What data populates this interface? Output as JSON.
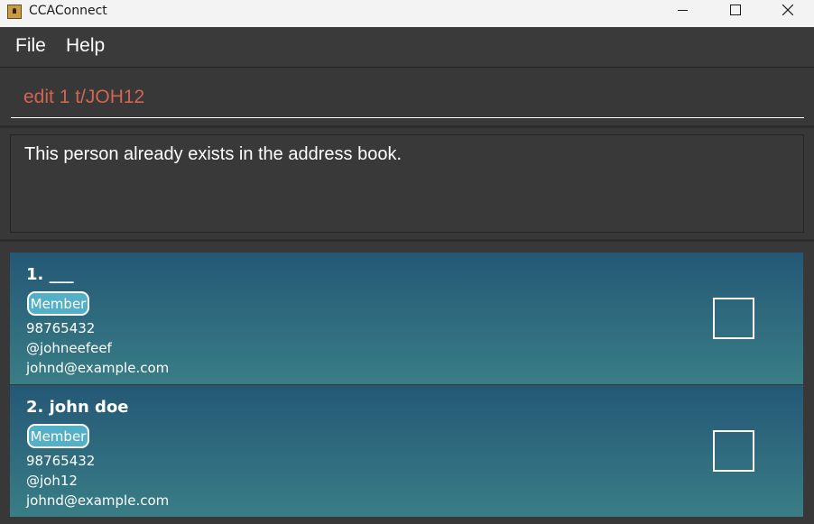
{
  "window": {
    "title": "CCAConnect"
  },
  "menu": {
    "file": "File",
    "help": "Help"
  },
  "command": {
    "value": "edit 1 t/JOH12"
  },
  "result": {
    "message": "This person already exists in the address book."
  },
  "persons": [
    {
      "name": "1. ___",
      "tag": "Member",
      "phone": "98765432",
      "telegram": "@johneefeef",
      "email": "johnd@example.com",
      "checked": false
    },
    {
      "name": "2. john doe",
      "tag": "Member",
      "phone": "98765432",
      "telegram": "@joh12",
      "email": "johnd@example.com",
      "checked": false
    }
  ],
  "colors": {
    "command_text": "#d06651",
    "card_top": "#245876",
    "card_bottom": "#397d86",
    "tag_fill": "#54b0c6"
  },
  "icons": [
    "app-icon",
    "minimize-icon",
    "maximize-icon",
    "close-icon"
  ]
}
